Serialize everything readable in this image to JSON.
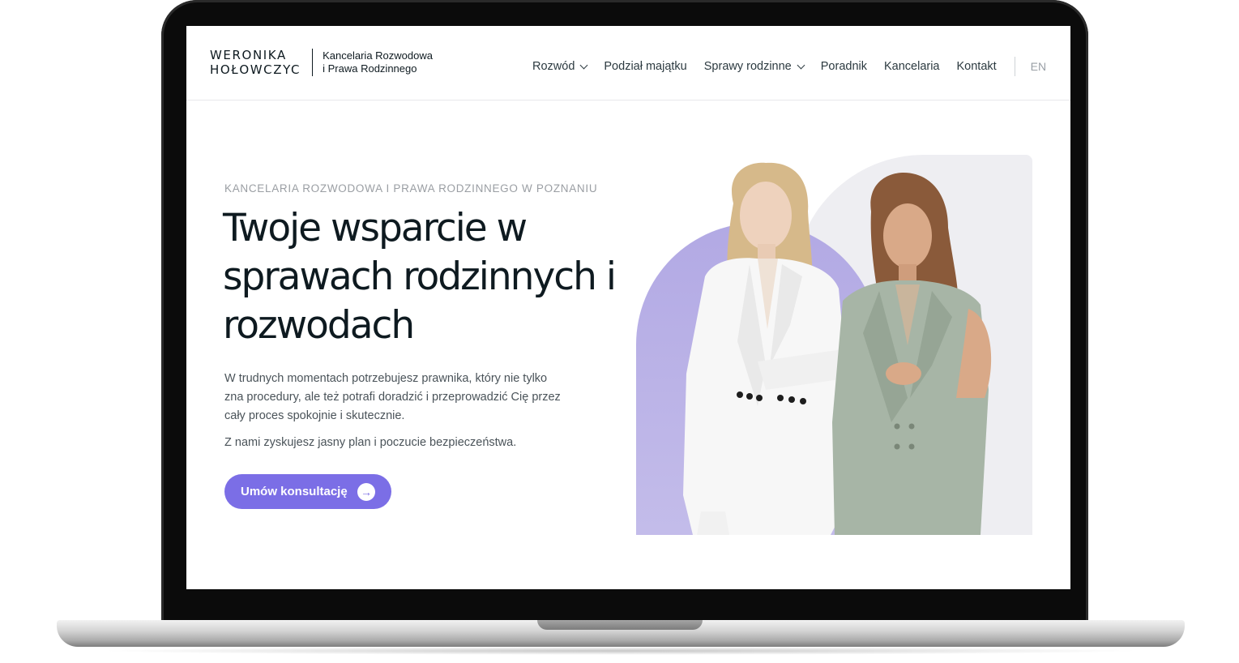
{
  "logo": {
    "name_line1": "WERONIKA",
    "name_line2": "HOŁOWCZYC",
    "tag_line1": "Kancelaria Rozwodowa",
    "tag_line2": "i Prawa Rodzinnego"
  },
  "nav": {
    "items": [
      {
        "label": "Rozwód",
        "has_dropdown": true
      },
      {
        "label": "Podział majątku",
        "has_dropdown": false
      },
      {
        "label": "Sprawy rodzinne",
        "has_dropdown": true
      },
      {
        "label": "Poradnik",
        "has_dropdown": false
      },
      {
        "label": "Kancelaria",
        "has_dropdown": false
      },
      {
        "label": "Kontakt",
        "has_dropdown": false
      }
    ],
    "language": "EN"
  },
  "hero": {
    "eyebrow": "KANCELARIA ROZWODOWA I PRAWA RODZINNEGO W POZNANIU",
    "title": "Twoje wsparcie w sprawach rodzinnych i rozwodach",
    "paragraph1": "W trudnych momentach potrzebujesz prawnika, który nie tylko zna procedury, ale też potrafi doradzić i przeprowadzić Cię przez cały proces spokojnie i skutecznie.",
    "paragraph2": "Z nami zyskujesz jasny plan i poczucie bezpieczeństwa.",
    "cta_label": "Umów konsultację",
    "cta_icon": "arrow-right-circle-icon"
  },
  "colors": {
    "accent": "#7b6ee6",
    "text_dark": "#0e1a20",
    "purple_shape": "#b2a9e4",
    "jacket_white": "#f7f7f7",
    "vest_sage": "#a7b5a6"
  }
}
